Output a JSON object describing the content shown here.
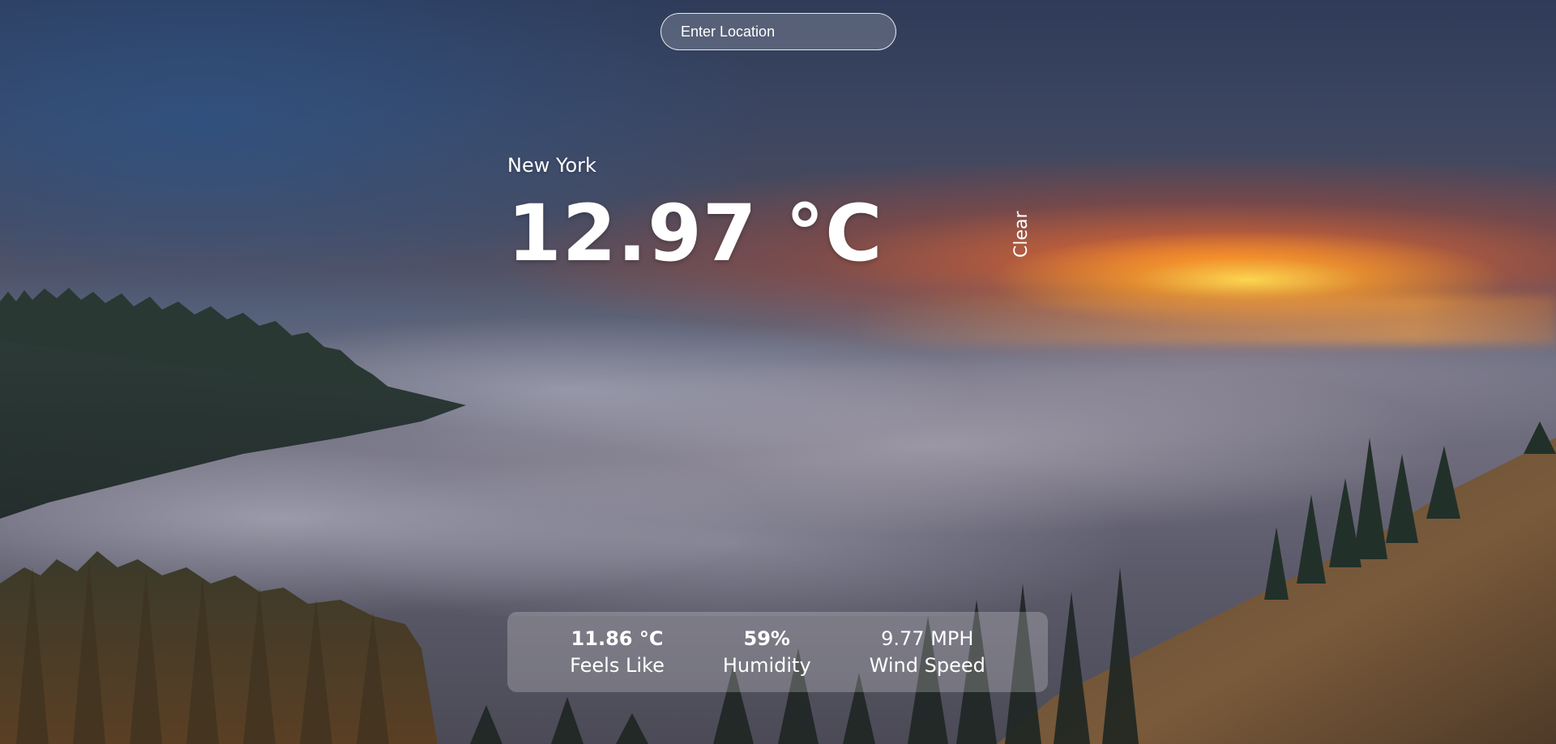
{
  "search": {
    "placeholder": "Enter Location"
  },
  "weather": {
    "location": "New York",
    "temperature": "12.97 °C",
    "condition": "Clear"
  },
  "stats": [
    {
      "value": "11.86 °C",
      "label": "Feels Like"
    },
    {
      "value": "59%",
      "label": "Humidity"
    },
    {
      "value": "9.77 MPH",
      "label": "Wind Speed"
    }
  ]
}
